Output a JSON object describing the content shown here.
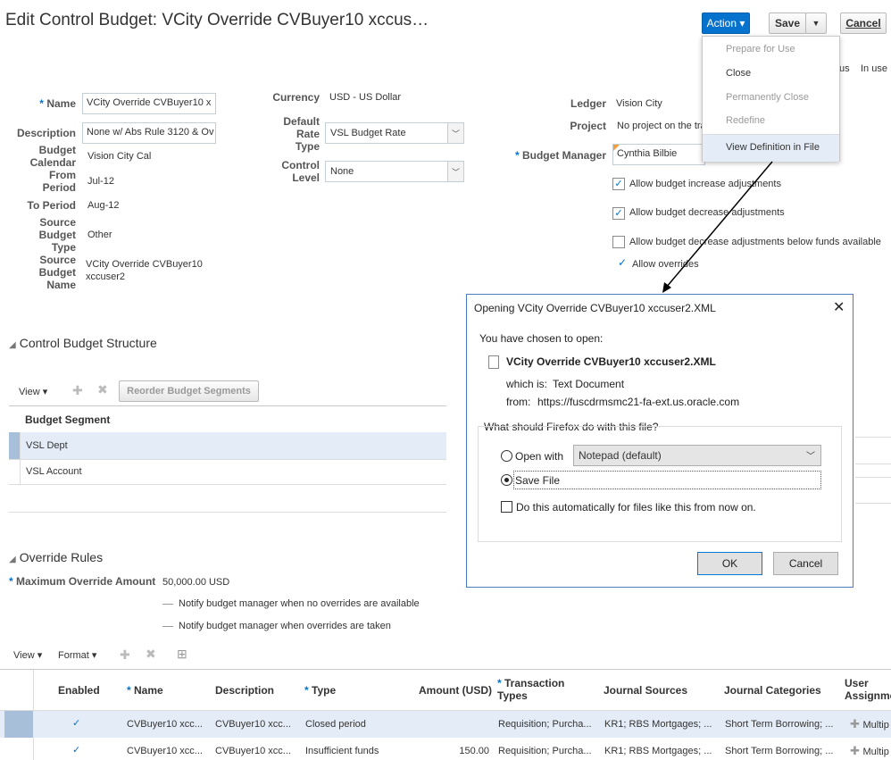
{
  "page_title": "Edit Control Budget: VCity Override CVBuyer10 xccus…",
  "toolbar": {
    "action_label": "Action ▾",
    "save_label": "Save",
    "save_menu": "▼",
    "cancel_label": "Cancel"
  },
  "status": {
    "fragment": "us",
    "in_use": "In use"
  },
  "action_menu": {
    "items": [
      {
        "label": "Prepare for Use",
        "enabled": false
      },
      {
        "label": "Close",
        "enabled": true
      },
      {
        "label": "Permanently Close",
        "enabled": false
      },
      {
        "label": "Redefine",
        "enabled": false
      },
      {
        "label": "View Definition in File",
        "enabled": true
      }
    ]
  },
  "form": {
    "name_label": "Name",
    "name_value": "VCity Override CVBuyer10 x",
    "description_label": "Description",
    "description_value": "None w/ Abs Rule 3120 & Ov",
    "calendar_label": [
      "Budget",
      "Calendar"
    ],
    "calendar_value": "Vision City Cal",
    "from_label": [
      "From",
      "Period"
    ],
    "from_value": "Jul-12",
    "to_label": "To Period",
    "to_value": "Aug-12",
    "source_type_label": [
      "Source",
      "Budget",
      "Type"
    ],
    "source_type_value": "Other",
    "source_name_label": [
      "Source",
      "Budget",
      "Name"
    ],
    "source_name_value": [
      "VCity Override CVBuyer10",
      "xccuser2"
    ],
    "currency_label": "Currency",
    "currency_value": "USD - US Dollar",
    "rate_label": [
      "Default",
      "Rate",
      "Type"
    ],
    "rate_value": "VSL Budget Rate",
    "control_label": [
      "Control",
      "Level"
    ],
    "control_value": "None",
    "ledger_label": "Ledger",
    "ledger_value": "Vision City",
    "project_label": "Project",
    "project_value": "No project on the tra",
    "manager_label": "Budget Manager",
    "manager_value": "Cynthia Bilbie",
    "checks": [
      {
        "label": "Allow budget increase adjustments",
        "checked": true
      },
      {
        "label": "Allow budget decrease adjustments",
        "checked": true
      },
      {
        "label": "Allow budget decrease adjustments below funds available",
        "checked": false
      }
    ],
    "allow_overrides": "Allow overrides"
  },
  "structure": {
    "title": "Control Budget Structure",
    "view_label": "View",
    "reorder_label": "Reorder Budget Segments",
    "column": "Budget Segment",
    "rows": [
      "VSL Dept",
      "VSL Account"
    ]
  },
  "override": {
    "title": "Override Rules",
    "max_label": "Maximum Override Amount",
    "max_value": "50,000.00 USD",
    "notify_none": "Notify budget manager when no overrides are available",
    "notify_taken": "Notify budget manager when overrides are taken",
    "view_label": "View",
    "format_label": "Format",
    "columns": [
      "Enabled",
      "Name",
      "Description",
      "Type",
      "Amount (USD)",
      "Transaction Types",
      "Journal Sources",
      "Journal Categories",
      "User Assignme"
    ],
    "rows": [
      {
        "enabled": "✓",
        "name": "CVBuyer10 xcc...",
        "description": "CVBuyer10 xcc...",
        "type": "Closed period",
        "amount": "",
        "txn": "Requisition; Purcha...",
        "sources": "KR1; RBS Mortgages; ...",
        "categories": "Short Term Borrowing; ...",
        "user": "Multip"
      },
      {
        "enabled": "✓",
        "name": "CVBuyer10 xcc...",
        "description": "CVBuyer10 xcc...",
        "type": "Insufficient funds",
        "amount": "150.00",
        "txn": "Requisition; Purcha...",
        "sources": "KR1; RBS Mortgages; ...",
        "categories": "Short Term Borrowing; ...",
        "user": "Multip"
      }
    ]
  },
  "dialog": {
    "title": "Opening VCity Override CVBuyer10 xccuser2.XML",
    "chosen": "You have chosen to open:",
    "filename": "VCity Override CVBuyer10 xccuser2.XML",
    "which_is_label": "which is:",
    "which_is_value": "Text Document",
    "from_label": "from:",
    "from_value": "https://fuscdrmsmc21-fa-ext.us.oracle.com",
    "question": "What should Firefox do with this file?",
    "open_with": "Open with",
    "app": "Notepad (default)",
    "save_file": "Save File",
    "auto": "Do this automatically for files like this from now on.",
    "ok": "OK",
    "cancel": "Cancel"
  }
}
